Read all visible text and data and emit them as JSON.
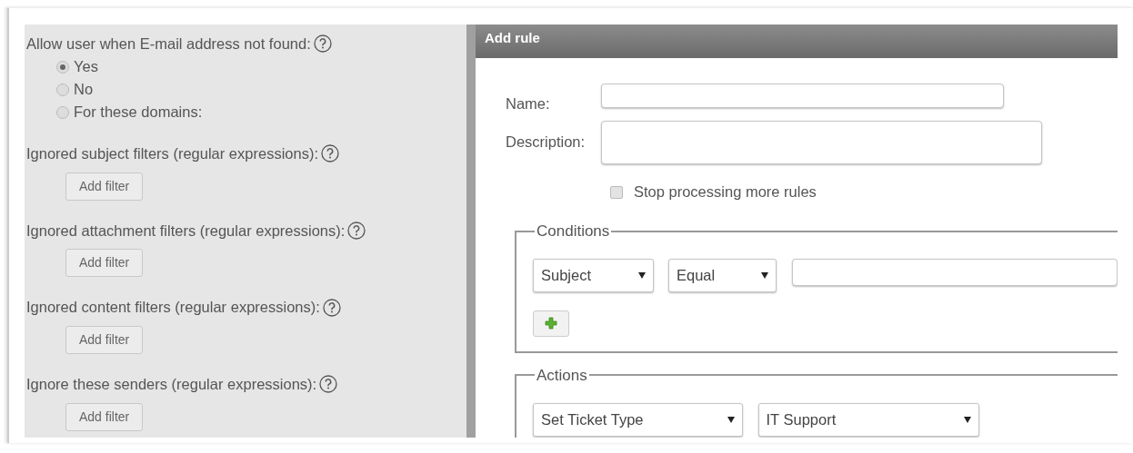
{
  "settings": {
    "groups": [
      {
        "kind": "radio",
        "label": "Allow user when E-mail address not found:",
        "options": [
          {
            "label": "Yes",
            "selected": true
          },
          {
            "label": "No",
            "selected": false
          },
          {
            "label": "For these domains:",
            "selected": false
          }
        ]
      },
      {
        "kind": "filter",
        "label": "Ignored subject filters (regular expressions):",
        "button": "Add filter"
      },
      {
        "kind": "filter",
        "label": "Ignored attachment filters (regular expressions):",
        "button": "Add filter"
      },
      {
        "kind": "filter",
        "label": "Ignored content filters (regular expressions):",
        "button": "Add filter"
      },
      {
        "kind": "filter",
        "label": "Ignore these senders (regular expressions):",
        "button": "Add filter"
      }
    ]
  },
  "dialog": {
    "title": "Add rule",
    "name_label": "Name:",
    "description_label": "Description:",
    "stop_processing": {
      "label": "Stop processing more rules",
      "checked": false
    },
    "conditions": {
      "legend": "Conditions",
      "field": "Subject",
      "operator": "Equal"
    },
    "actions": {
      "legend": "Actions",
      "action": "Set Ticket Type",
      "value": "IT Support"
    }
  }
}
